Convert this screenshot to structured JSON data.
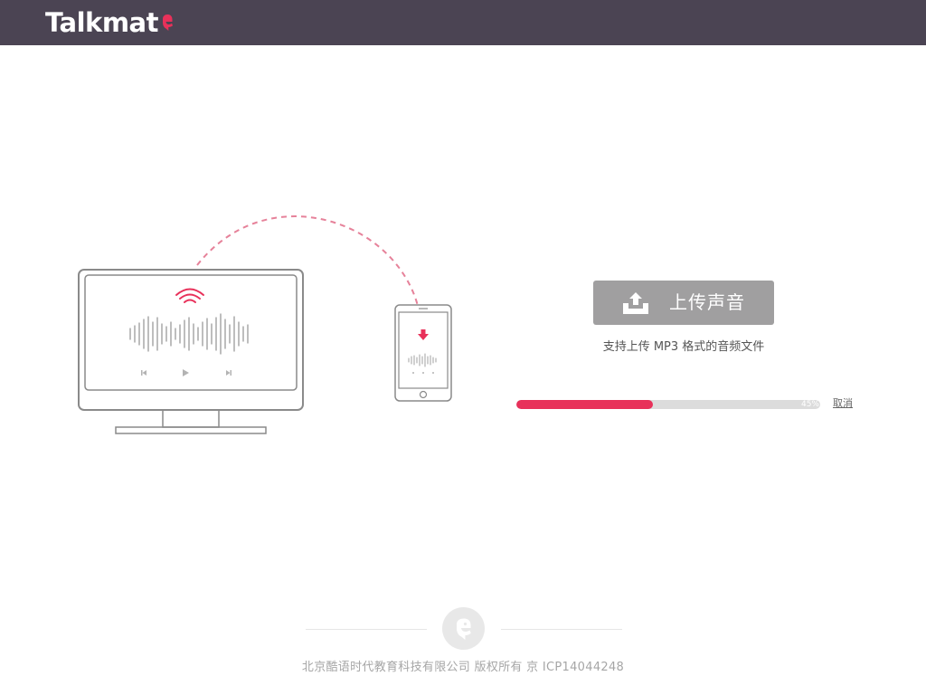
{
  "app": {
    "brand_name": "Talkmat",
    "brand_color": "#e8315a",
    "topbar_color": "#4b4453"
  },
  "illustration": {
    "icons": [
      "monitor-icon",
      "wifi-icon",
      "waveform-icon",
      "previous-icon",
      "play-icon",
      "next-icon",
      "phone-icon",
      "download-arrow-icon"
    ]
  },
  "upload": {
    "button_label": "上传声音",
    "icon": "upload-tray-icon",
    "hint": "支持上传 MP3 格式的音频文件"
  },
  "progress": {
    "percent": 45,
    "percent_label": "45%",
    "cancel_label": "取消"
  },
  "footer": {
    "logo_icon": "talkmate-logo-icon",
    "copyright": "北京酷语时代教育科技有限公司 版权所有 京 ICP14044248"
  }
}
